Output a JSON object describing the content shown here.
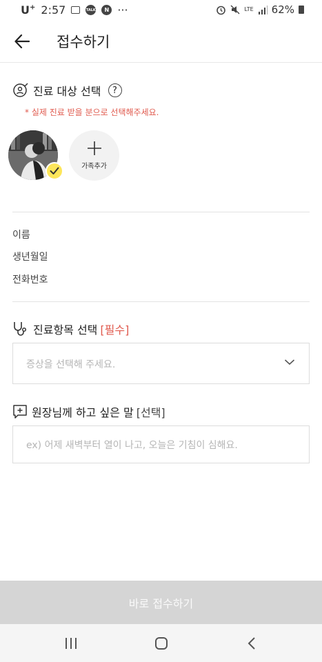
{
  "status_bar": {
    "carrier": "U",
    "carrier_sup": "+",
    "time": "2:57",
    "notif_talk": "TALK",
    "notif_n": "N",
    "more": "···",
    "network": "LTE",
    "battery": "62%"
  },
  "header": {
    "title": "접수하기"
  },
  "patient": {
    "title": "진료 대상 선택",
    "help": "?",
    "notice": "* 실제 진료 받을 분으로 선택해주세요.",
    "add_family_label": "가족추가"
  },
  "info": {
    "name_label": "이름",
    "birth_label": "생년월일",
    "phone_label": "전화번호"
  },
  "symptom": {
    "title": "진료항목 선택",
    "required": "[필수]",
    "placeholder": "증상을 선택해 주세요."
  },
  "memo": {
    "title": "원장님께 하고 싶은 말",
    "optional": "[선택]",
    "placeholder": "ex) 어제 새벽부터 열이 나고, 오늘은 기침이 심해요."
  },
  "submit": {
    "label": "바로 접수하기"
  },
  "colors": {
    "accent_red": "#e05a4e",
    "check_yellow": "#fde65a",
    "button_disabled": "#d5d5d5"
  }
}
